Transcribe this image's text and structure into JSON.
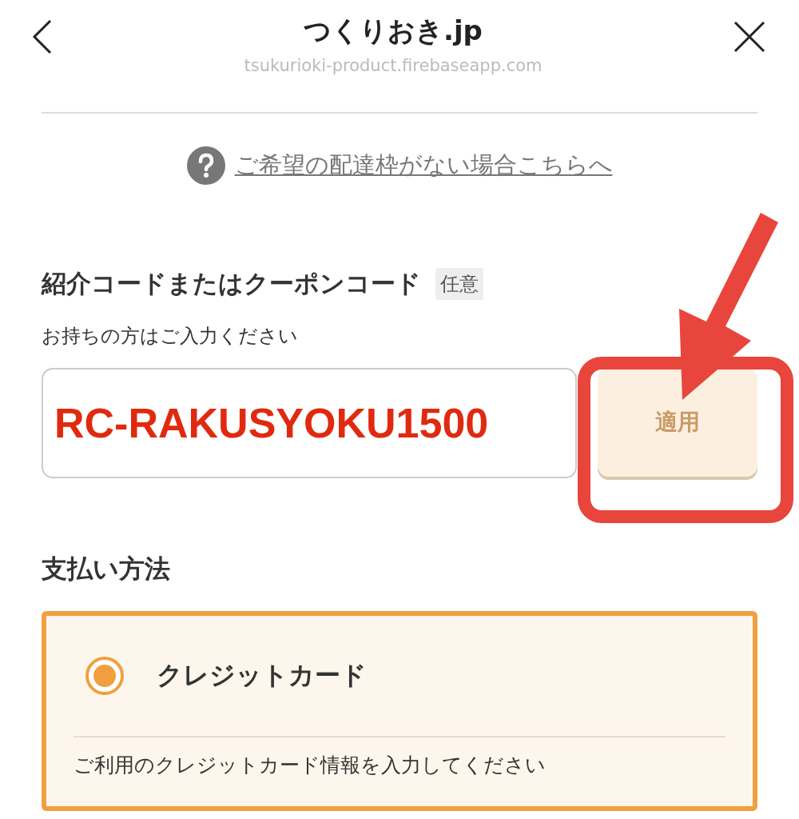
{
  "header": {
    "title": "つくりおき.jp",
    "url": "tsukurioki-product.firebaseapp.com"
  },
  "help_link": "ご希望の配達枠がない場合こちらへ",
  "coupon": {
    "label": "紹介コードまたはクーポンコード",
    "badge": "任意",
    "hint": "お持ちの方はご入力ください",
    "value": "RC-RAKUSYOKU1500",
    "button": {
      "label": "適用",
      "disabled": true
    }
  },
  "payment": {
    "title": "支払い方法",
    "methods": [
      {
        "label": "クレジットカード",
        "selected": true,
        "description": "ご利用のクレジットカード情報を入力してください"
      }
    ]
  }
}
